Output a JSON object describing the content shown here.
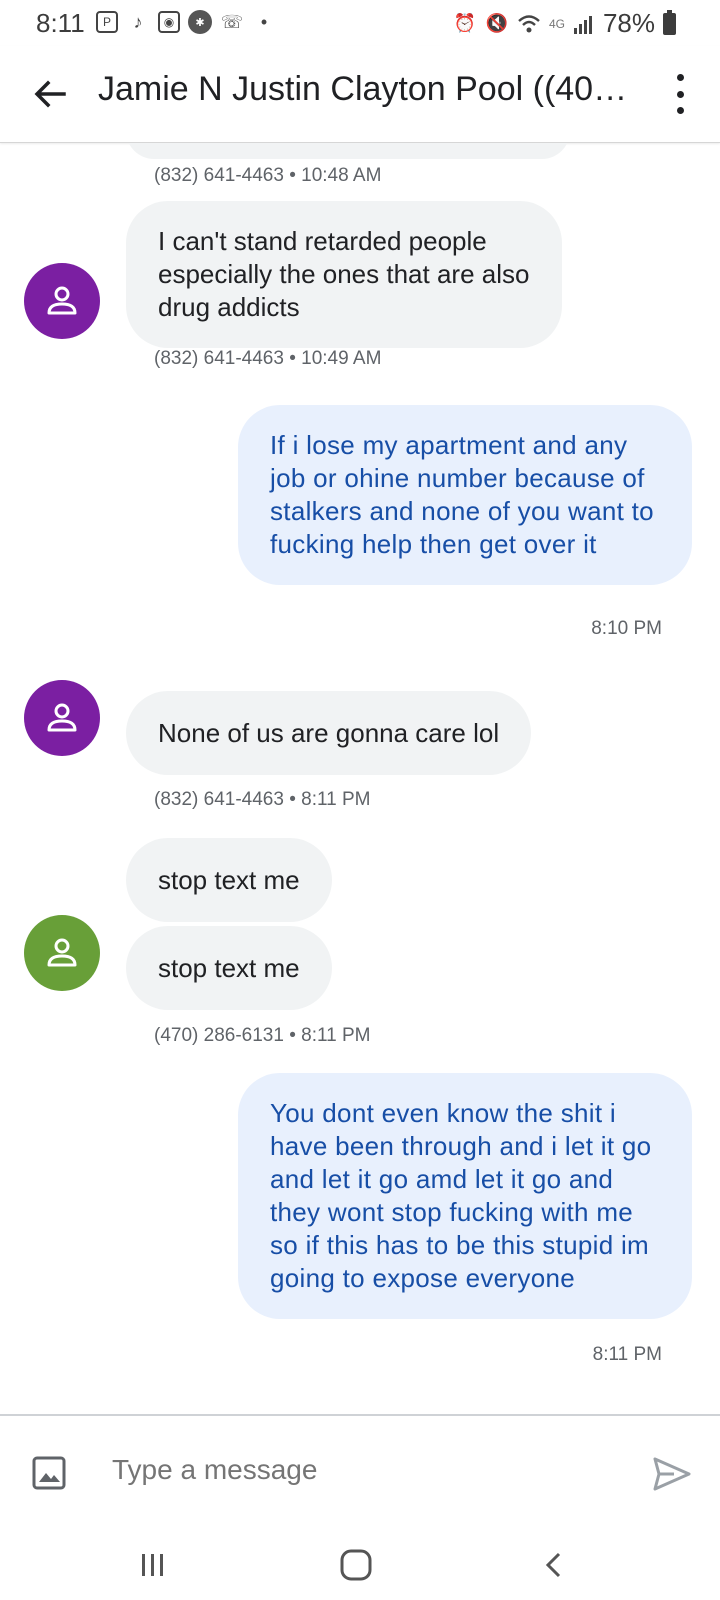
{
  "status_bar": {
    "time": "8:11",
    "battery": "78%",
    "network": "4G",
    "icons": [
      "notification-icon",
      "tiktok-icon",
      "app-icon",
      "app-icon-2",
      "wifi-call-icon",
      "dot-icon",
      "alarm-icon",
      "mute-icon",
      "wifi-icon",
      "signal-icon",
      "battery-icon"
    ]
  },
  "header": {
    "title": "Jamie N Justin Clayton Pool ((40…",
    "back_icon": "arrow-left-icon",
    "menu_icon": "more-vert-icon"
  },
  "messages": [
    {
      "direction": "in",
      "meta": "(832) 641-4463 • 10:48 AM"
    },
    {
      "direction": "in",
      "text": "I can't stand retarded people especially the ones that are also drug addicts",
      "meta": "(832) 641-4463 • 10:49 AM",
      "avatar_color": "#7b1fa2"
    },
    {
      "direction": "out",
      "text": "If i lose my apartment and any job or ohine number because of stalkers and none of you want to fucking help then get over it",
      "meta": "8:10 PM"
    },
    {
      "direction": "in",
      "text": "None of us are gonna care lol",
      "meta": "(832) 641-4463 • 8:11 PM",
      "avatar_color": "#7b1fa2"
    },
    {
      "direction": "in",
      "text": "stop text me"
    },
    {
      "direction": "in",
      "text": "stop text me",
      "meta": "(470) 286-6131 • 8:11 PM",
      "avatar_color": "#689f38"
    },
    {
      "direction": "out",
      "text": "You dont even know the shit i have been through and i let it go and let it go amd let it go and they wont stop fucking with me so if this has to be this stupid im going to expose everyone",
      "meta": "8:11 PM"
    }
  ],
  "compose": {
    "placeholder": "Type a message",
    "gallery_icon": "image-icon",
    "send_icon": "send-icon"
  },
  "nav": [
    "recents-icon",
    "home-icon",
    "back-icon"
  ],
  "colors": {
    "incoming_bubble": "#f1f3f4",
    "outgoing_bubble": "#e8f0fd",
    "outgoing_text": "#174ea6",
    "avatar_purple": "#7b1fa2",
    "avatar_green": "#689f38"
  }
}
